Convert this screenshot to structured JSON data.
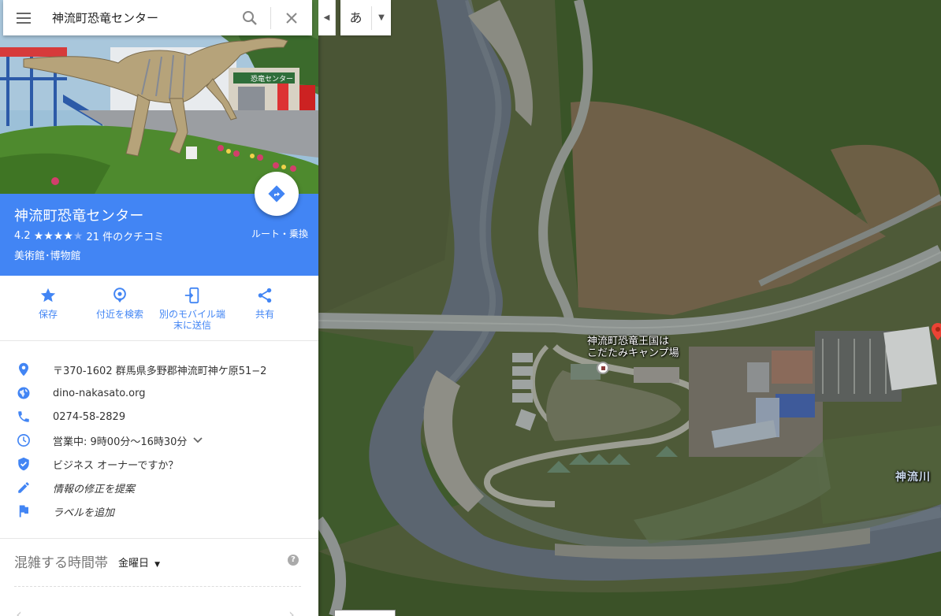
{
  "search": {
    "query": "神流町恐竜センター"
  },
  "place": {
    "name": "神流町恐竜センター",
    "rating": "4.2",
    "stars_filled": 4,
    "stars_total": 5,
    "review_count": "21 件のクチコミ",
    "category": "美術館･博物館",
    "route_label": "ルート・乗換"
  },
  "hero": {
    "sign_text": "恐竜センター"
  },
  "actions": [
    {
      "label": "保存",
      "icon": "star-icon"
    },
    {
      "label": "付近を検索",
      "icon": "nearby-search-icon"
    },
    {
      "label": "別のモバイル端末に送信",
      "icon": "send-to-device-icon"
    },
    {
      "label": "共有",
      "icon": "share-icon"
    }
  ],
  "info": {
    "address": "〒370-1602 群馬県多野郡神流町神ケ原51−2",
    "website": "dino-nakasato.org",
    "phone": "0274-58-2829",
    "hours_status": "営業中:",
    "hours": "9時00分～16時30分",
    "claim": "ビジネス オーナーですか？",
    "suggest_edit": "情報の修正を提案",
    "add_label": "ラベルを追加"
  },
  "popular_times": {
    "label": "混雑する時間帯",
    "day": "金曜日"
  },
  "ime": {
    "lang_char": "あ"
  },
  "map": {
    "camp_label_line1": "神流町恐竜王国は",
    "camp_label_line2": "こだたみキャンプ場",
    "river_label": "神流川"
  },
  "colors": {
    "accent": "#4285f4",
    "pin_red": "#ea4335"
  }
}
